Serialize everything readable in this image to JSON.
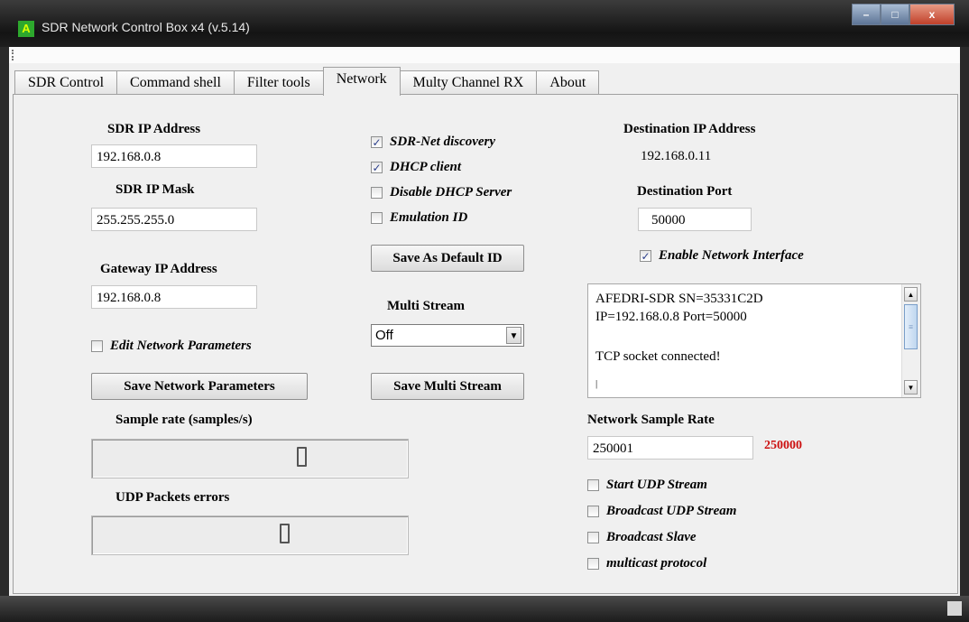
{
  "window": {
    "title": "SDR Network Control Box x4 (v.5.14)",
    "icon_glyph": "A",
    "minimize_glyph": "–",
    "maximize_glyph": "□",
    "close_glyph": "x"
  },
  "tabs": [
    {
      "label": "SDR Control",
      "active": false
    },
    {
      "label": "Command shell",
      "active": false
    },
    {
      "label": "Filter tools",
      "active": false
    },
    {
      "label": "Network",
      "active": true
    },
    {
      "label": "Multy Channel RX",
      "active": false
    },
    {
      "label": "About",
      "active": false
    }
  ],
  "left": {
    "sdr_ip_label": "SDR IP Address",
    "sdr_ip_value": "192.168.0.8",
    "sdr_mask_label": "SDR IP Mask",
    "sdr_mask_value": "255.255.255.0",
    "gateway_label": "Gateway IP Address",
    "gateway_value": "192.168.0.8",
    "edit_params_label": "Edit Network Parameters",
    "edit_params_checked": false,
    "save_params_button": "Save Network Parameters",
    "sample_rate_label": "Sample rate (samples/s)",
    "sample_rate_digit": "0",
    "udp_errors_label": "UDP Packets errors",
    "udp_errors_digit": "0"
  },
  "middle": {
    "checks": [
      {
        "label": "SDR-Net discovery",
        "checked": true
      },
      {
        "label": "DHCP client",
        "checked": true
      },
      {
        "label": "Disable DHCP Server",
        "checked": false
      },
      {
        "label": "Emulation ID",
        "checked": false
      }
    ],
    "save_default_button": "Save As Default ID",
    "multi_stream_label": "Multi Stream",
    "multi_stream_value": "Off",
    "save_multi_button": "Save Multi Stream"
  },
  "right": {
    "dest_ip_label": "Destination IP Address",
    "dest_ip_value": "192.168.0.11",
    "dest_port_label": "Destination Port",
    "dest_port_value": "50000",
    "enable_iface_label": "Enable Network Interface",
    "enable_iface_checked": true,
    "log_lines": [
      "AFEDRI-SDR   SN=35331C2D",
      "IP=192.168.0.8   Port=50000",
      "",
      "TCP socket connected!",
      "|"
    ],
    "net_sample_rate_label": "Network Sample Rate",
    "net_sample_rate_value": "250001",
    "net_sample_rate_actual": "250000",
    "actual_color": "#cc1111",
    "stream_checks": [
      {
        "label": "Start UDP Stream",
        "checked": false
      },
      {
        "label": "Broadcast UDP Stream",
        "checked": false
      },
      {
        "label": "Broadcast Slave",
        "checked": false
      },
      {
        "label": "multicast protocol",
        "checked": false
      }
    ]
  },
  "check_glyph": "✓"
}
